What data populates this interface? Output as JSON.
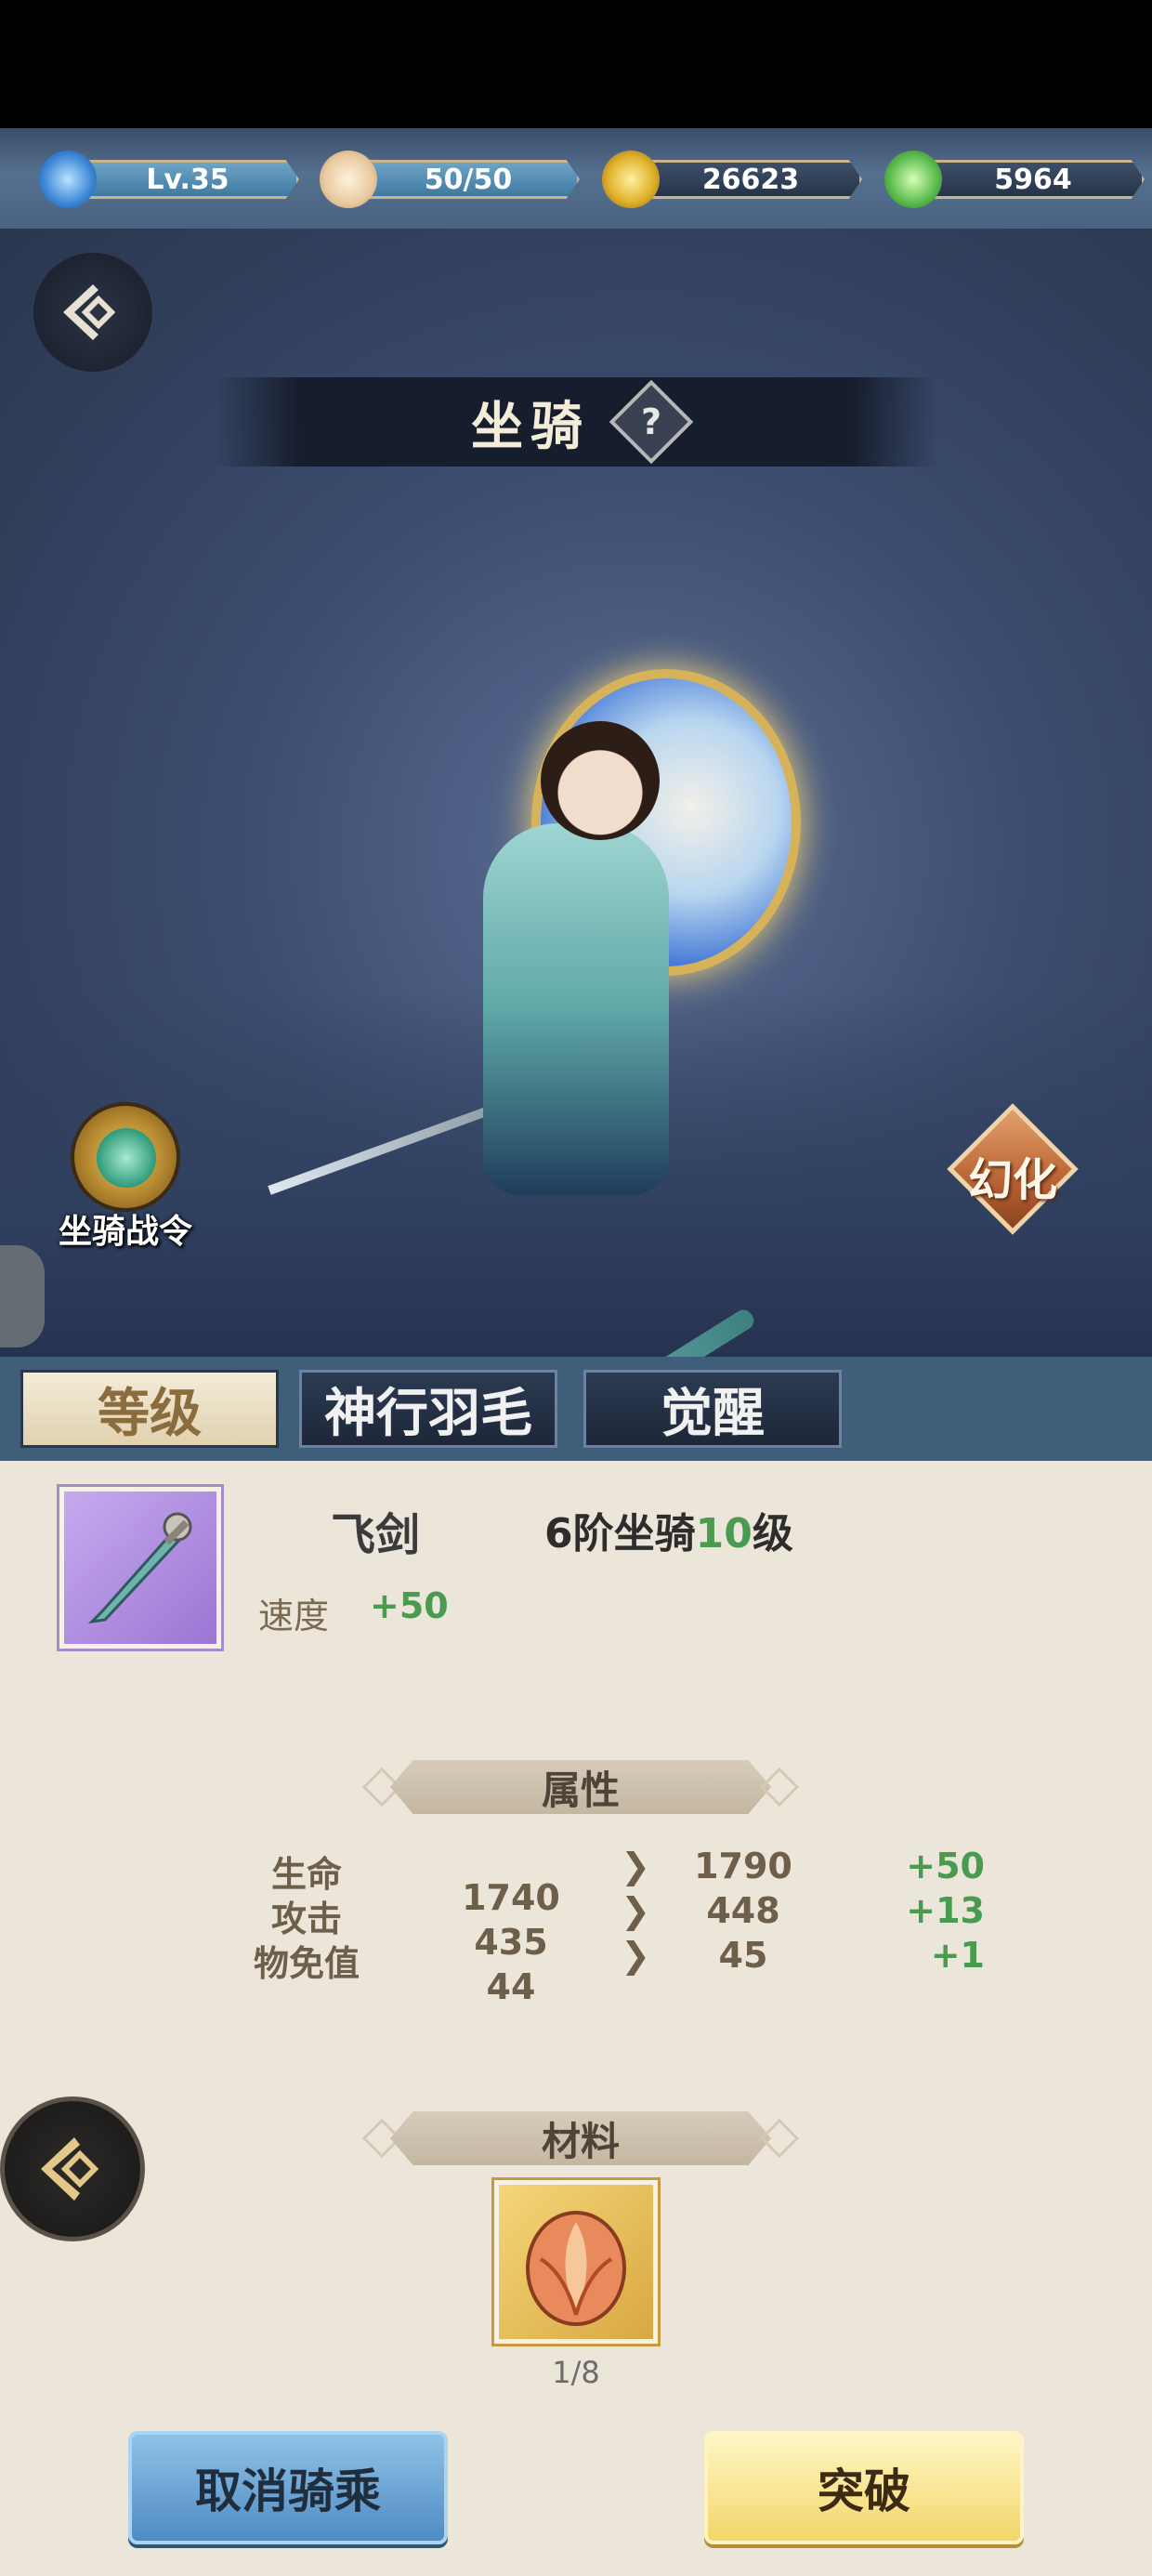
{
  "currencies": [
    {
      "label": "Lv.35",
      "icon": "level-swirl-icon"
    },
    {
      "label": "50/50",
      "icon": "stamina-bun-icon"
    },
    {
      "label": "26623",
      "icon": "gold-coin-icon"
    },
    {
      "label": "5964",
      "icon": "jade-leaf-icon"
    }
  ],
  "title": "坐骑",
  "help_symbol": "?",
  "mount_pass_label": "坐骑战令",
  "transform_label": "幻化",
  "tabs": [
    "等级",
    "神行羽毛",
    "觉醒"
  ],
  "item": {
    "name": "飞剑",
    "level_prefix": "6阶坐骑",
    "level_num": "10",
    "level_suffix": "级",
    "speed_label": "速度",
    "speed_value": "+50"
  },
  "attributes_title": "属性",
  "attributes": [
    {
      "name": "生命",
      "current": "1740",
      "next": "1790",
      "diff": "+50"
    },
    {
      "name": "攻击",
      "current": "435",
      "next": "448",
      "diff": "+13"
    },
    {
      "name": "物免值",
      "current": "44",
      "next": "45",
      "diff": "+1"
    }
  ],
  "materials_title": "材料",
  "material_count": "1/8",
  "buttons": {
    "cancel": "取消骑乘",
    "break": "突破"
  },
  "colors": {
    "accent_green": "#4a9a4f",
    "tab_bar": "#3e5e79",
    "panel_bg": "#ece6da"
  }
}
